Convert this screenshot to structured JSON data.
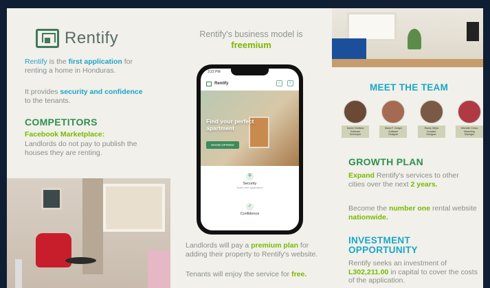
{
  "brand": {
    "name": "Rentify"
  },
  "left": {
    "intro": {
      "brand": "Rentify",
      "t1": " is the ",
      "first": "first application",
      "t2": " for renting a home in Honduras."
    },
    "provides": {
      "t1": "It provides ",
      "security": "security and confidence",
      "t2": " to the tenants."
    },
    "competitors": {
      "heading": "COMPETITORS",
      "name": "Facebook Marketplace:",
      "text": "Landlords do not pay to publish the houses they are renting."
    }
  },
  "center": {
    "title": "Rentify's business model is",
    "model": "freemium",
    "landlords": {
      "t1": "Landlords will pay a ",
      "premium": "premium plan",
      "t2": " for adding their property to Rentify's website."
    },
    "tenants": {
      "t1": "Tenants will enjoy the service for ",
      "free": "free."
    }
  },
  "phone": {
    "time": "3:22 PM",
    "app_name": "Rentify",
    "hero_text": "Find your perfect apartment",
    "hero_button": "SHOW OFFERS",
    "features": [
      {
        "title": "Security",
        "sub": "Scam free application"
      },
      {
        "title": "Confidence",
        "sub": ""
      }
    ]
  },
  "right": {
    "team_heading": "MEET THE TEAM",
    "team": [
      {
        "name": "Daniel Orellana",
        "role1": "Software",
        "role2": "Developer",
        "color": "#6b4a35"
      },
      {
        "name": "Maria F. Zelaya",
        "role1": "Software",
        "role2": "Designer",
        "color": "#a56a52"
      },
      {
        "name": "Randy Mejía",
        "role1": "Creative",
        "role2": "Designer",
        "color": "#7a5a45"
      },
      {
        "name": "Michelle Cerna",
        "role1": "Marketing",
        "role2": "Manager",
        "color": "#b03a44"
      }
    ],
    "growth": {
      "heading": "GROWTH PLAN",
      "t1_expand": "Expand",
      "t1": " Rentify's services to other cities over the next ",
      "years": "2 years.",
      "t2": "Become the ",
      "number_one": "number one",
      "t3": " rental website ",
      "nationwide": "nationwide."
    },
    "investment": {
      "heading": "INVESTMENT OPPORTUNITY",
      "t1": "Rentify seeks an investment of ",
      "amount": "L302,211.00",
      "t2": " in capital to cover the costs of the application."
    }
  }
}
